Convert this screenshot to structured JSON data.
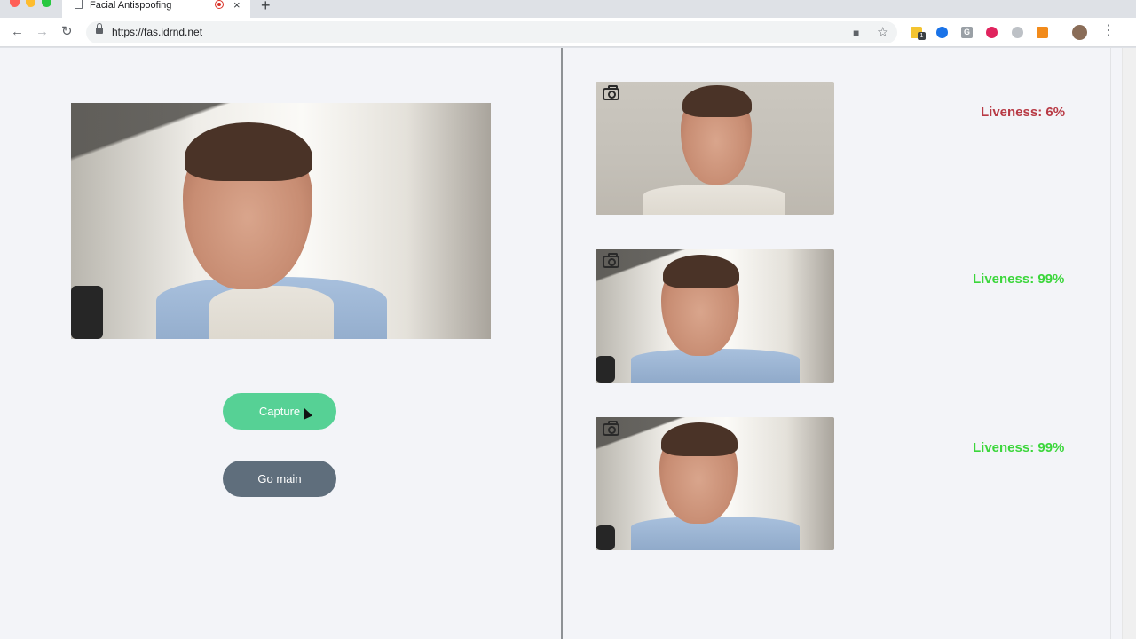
{
  "browser": {
    "tab_title": "Facial Antispoofing",
    "new_tab_symbol": "+",
    "close_symbol": "×",
    "url": "https://fas.idrnd.net",
    "back_symbol": "←",
    "forward_symbol": "→",
    "reload_symbol": "↻",
    "star_symbol": "☆",
    "menu_symbol": "⋮",
    "camera_indicator_symbol": "■",
    "extension_badge": "1",
    "extension_letter": "G",
    "icons": [
      "page-icon",
      "recording-icon",
      "close-icon",
      "lock-icon",
      "camera-icon",
      "star-icon",
      "avatar",
      "menu-icon"
    ]
  },
  "main": {
    "capture_label": "Capture",
    "go_main_label": "Go main"
  },
  "results": [
    {
      "liveness": "Liveness: 6%",
      "status": "bad"
    },
    {
      "liveness": "Liveness: 99%",
      "status": "good"
    },
    {
      "liveness": "Liveness: 99%",
      "status": "good"
    }
  ],
  "colors": {
    "capture_button": "#56d195",
    "go_main_button": "#5f6e7c",
    "liveness_low": "#b83a45",
    "liveness_high": "#3bd63b",
    "page_background": "#f3f4f8"
  }
}
